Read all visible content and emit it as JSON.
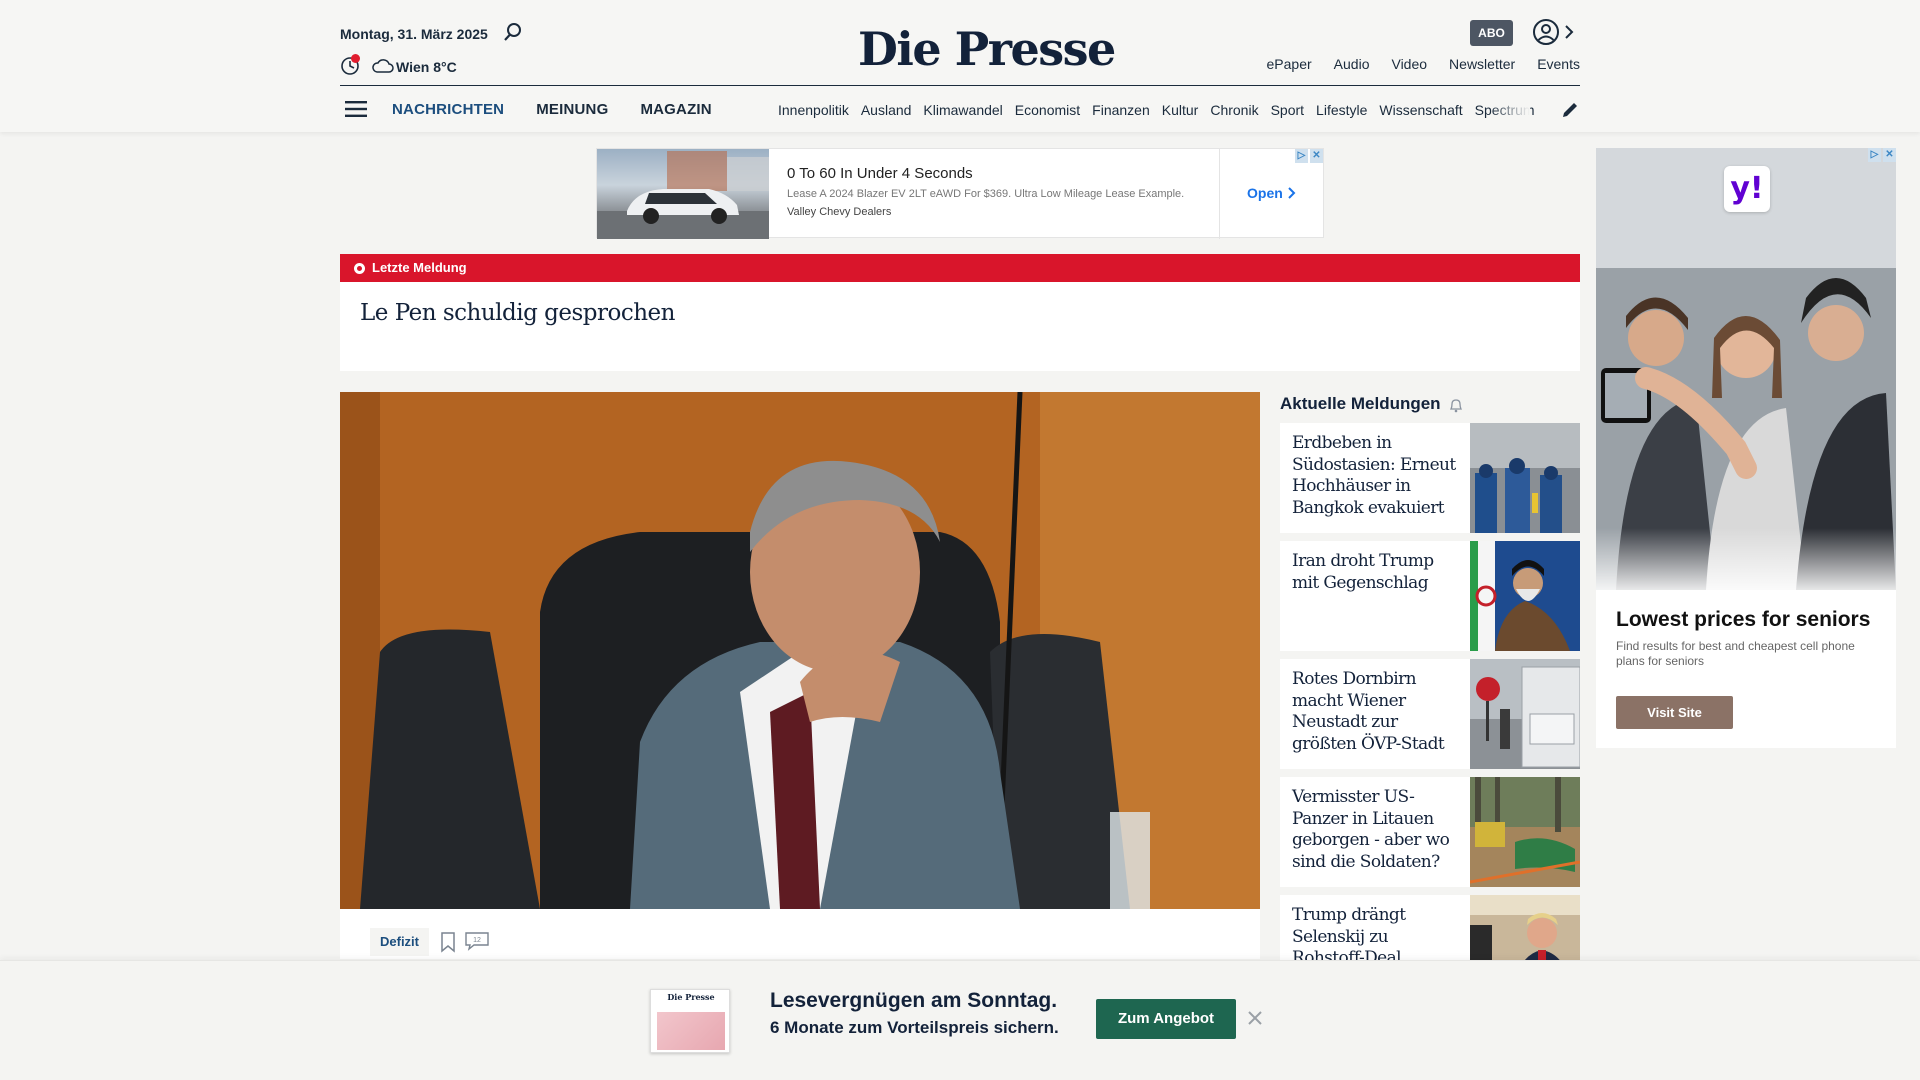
{
  "header": {
    "date": "Montag, 31. März 2025",
    "weather": "Wien 8°C",
    "logo": "Die Presse",
    "abo_label": "ABO",
    "top_links": [
      "ePaper",
      "Audio",
      "Video",
      "Newsletter",
      "Events"
    ],
    "nav_main": [
      "NACHRICHTEN",
      "MEINUNG",
      "MAGAZIN"
    ],
    "nav_sub": [
      "Innenpolitik",
      "Ausland",
      "Klimawandel",
      "Economist",
      "Finanzen",
      "Kultur",
      "Chronik",
      "Sport",
      "Lifestyle",
      "Wissenschaft",
      "Spectrum"
    ]
  },
  "ad_top": {
    "title": "0 To 60 In Under 4 Seconds",
    "description": "Lease A 2024 Blazer EV 2LT eAWD For $369. Ultra Low Mileage Lease Example.",
    "source": "Valley Chevy Dealers",
    "cta": "Open"
  },
  "breaking": {
    "label": "Letzte Meldung",
    "headline": "Le Pen schuldig gesprochen"
  },
  "hero": {
    "tag": "Defizit",
    "comment_count": "12"
  },
  "news": {
    "title": "Aktuelle Meldungen",
    "items": [
      {
        "text": "Erdbeben in Südostasien: Erneut Hochhäuser in Bangkok evakuiert"
      },
      {
        "text": "Iran droht Trump mit Gegenschlag"
      },
      {
        "text": "Rotes Dornbirn macht Wiener Neustadt zur größten ÖVP-Stadt"
      },
      {
        "text": "Vermisster US-Panzer in Litauen geborgen - aber wo sind die Soldaten?"
      },
      {
        "text": "Trump drängt Selenskij zu Rohstoff-Deal"
      }
    ]
  },
  "ad_right": {
    "brand": "y!",
    "title": "Lowest prices for seniors",
    "description": "Find results for best and cheapest cell phone plans for seniors",
    "cta": "Visit Site"
  },
  "bottom_banner": {
    "paper_title": "Die Presse",
    "line1": "Lesevergnügen am Sonntag.",
    "line2": "6 Monate zum Vorteilspreis sichern.",
    "cta": "Zum Angebot"
  },
  "colors": {
    "breaking_red": "#d9152b",
    "nav_active": "#1c4e7e",
    "cta_green": "#1e6650",
    "abo_gray": "#4d5663"
  }
}
